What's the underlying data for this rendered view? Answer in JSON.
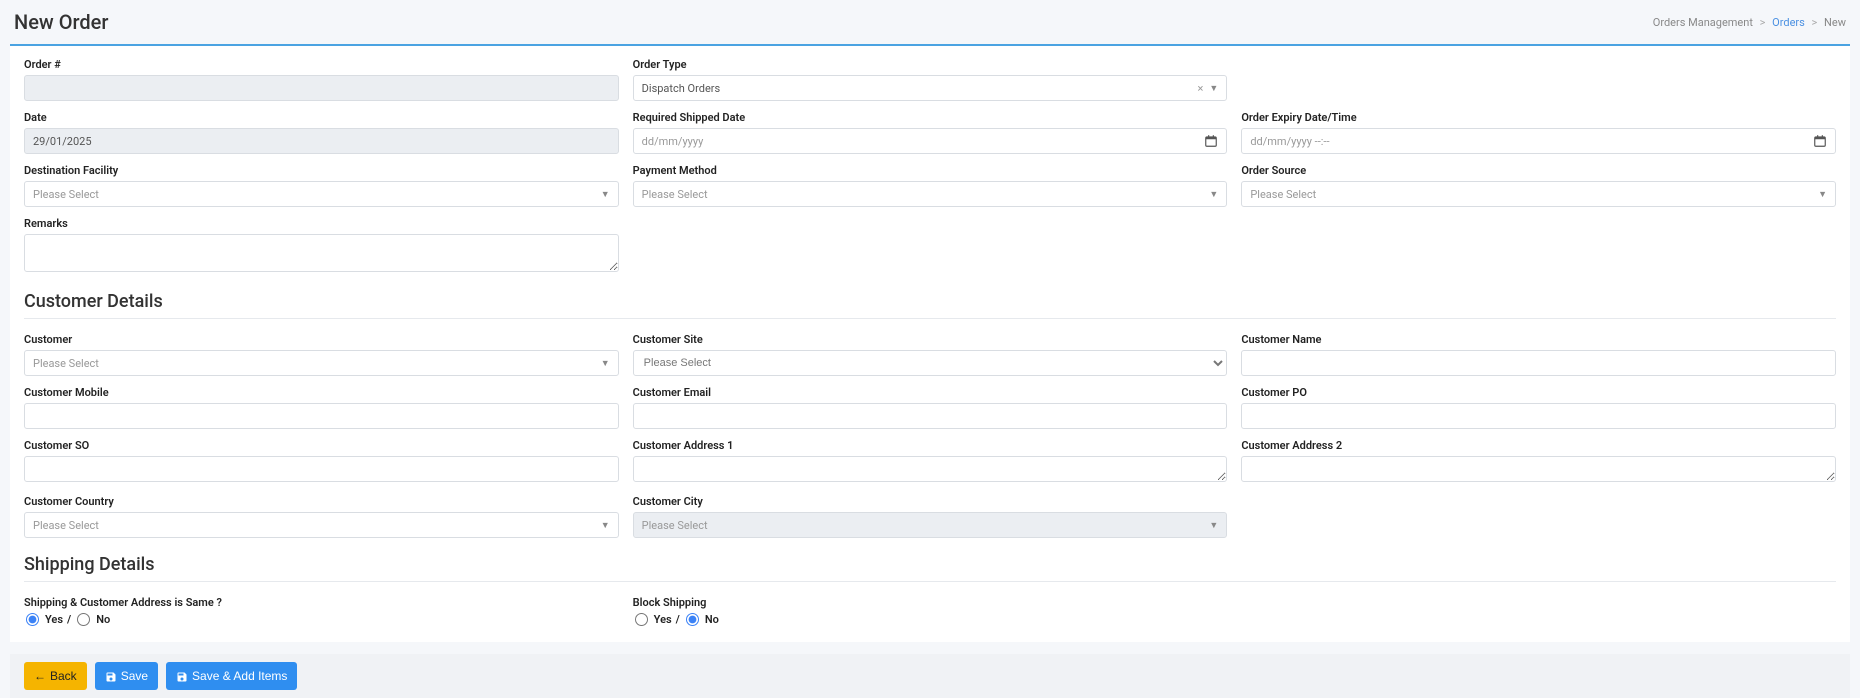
{
  "page": {
    "title": "New Order",
    "breadcrumb": {
      "root": "Orders Management",
      "link": "Orders",
      "current": "New"
    }
  },
  "orderInfo": {
    "orderNumLabel": "Order #",
    "orderNumValue": "",
    "orderTypeLabel": "Order Type",
    "orderTypeValue": "Dispatch Orders",
    "dateLabel": "Date",
    "dateValue": "29/01/2025",
    "reqShipDateLabel": "Required Shipped Date",
    "reqShipDatePlaceholder": "dd/mm/yyyy",
    "expiryLabel": "Order Expiry Date/Time",
    "expiryPlaceholder": "dd/mm/yyyy --:--",
    "destFacilityLabel": "Destination Facility",
    "destFacilityPlaceholder": "Please Select",
    "paymentLabel": "Payment Method",
    "paymentPlaceholder": "Please Select",
    "sourceLabel": "Order Source",
    "sourcePlaceholder": "Please Select",
    "remarksLabel": "Remarks"
  },
  "customer": {
    "sectionTitle": "Customer Details",
    "customerLabel": "Customer",
    "customerPlaceholder": "Please Select",
    "siteLabel": "Customer Site",
    "siteOption": "Please Select",
    "nameLabel": "Customer Name",
    "mobileLabel": "Customer Mobile",
    "emailLabel": "Customer Email",
    "poLabel": "Customer PO",
    "soLabel": "Customer SO",
    "addr1Label": "Customer Address 1",
    "addr2Label": "Customer Address 2",
    "countryLabel": "Customer Country",
    "countryPlaceholder": "Please Select",
    "cityLabel": "Customer City",
    "cityPlaceholder": "Please Select"
  },
  "shipping": {
    "sectionTitle": "Shipping Details",
    "sameAddrLabel": "Shipping & Customer Address is Same ?",
    "blockLabel": "Block Shipping",
    "yes": "Yes",
    "no": "No"
  },
  "buttons": {
    "back": "Back",
    "save": "Save",
    "saveAdd": "Save & Add Items"
  }
}
